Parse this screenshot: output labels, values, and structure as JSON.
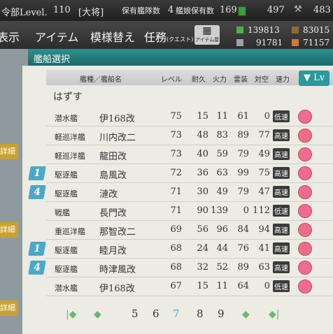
{
  "topbar": {
    "hq": "令部Level.",
    "level": "110",
    "rank": "[大将]",
    "ship_label": "保有艦隊数",
    "ship_value": "4",
    "equip_label": "艦娘保有数",
    "equip_value": "169",
    "bucket_value": "497",
    "c2_value": "483"
  },
  "menu": {
    "m1": "表示",
    "m2": "アイテム",
    "m3": "模様替え",
    "m4": "任務",
    "m4_sub": "(クエスト)",
    "itemshop": "アイテム屋"
  },
  "resources": {
    "fuel": "139813",
    "ammo": "83015",
    "steel": "91781",
    "bauxite": "71157"
  },
  "section_title": "艦船選択",
  "table": {
    "col_name": "艦種／艦船名",
    "col_level": "レベル",
    "col_hp": "耐久",
    "col_fp": "火力",
    "col_tp": "雷装",
    "col_aa": "対空",
    "col_speed": "速力",
    "sort_label": "▼ Lv",
    "remove": "はずす",
    "rows": [
      {
        "type": "潜水艦",
        "name": "伊168改",
        "lv": "75",
        "hp": "15",
        "fp": "11",
        "tp": "61",
        "aa": "0",
        "speed": "低速",
        "badge": ""
      },
      {
        "type": "軽巡洋艦",
        "name": "川内改二",
        "lv": "73",
        "hp": "48",
        "fp": "83",
        "tp": "89",
        "aa": "77",
        "speed": "高速",
        "badge": ""
      },
      {
        "type": "軽巡洋艦",
        "name": "龍田改",
        "lv": "73",
        "hp": "40",
        "fp": "59",
        "tp": "79",
        "aa": "49",
        "speed": "高速",
        "badge": ""
      },
      {
        "type": "駆逐艦",
        "name": "島風改",
        "lv": "72",
        "hp": "36",
        "fp": "63",
        "tp": "99",
        "aa": "75",
        "speed": "高速",
        "badge": "1"
      },
      {
        "type": "駆逐艦",
        "name": "漣改",
        "lv": "71",
        "hp": "30",
        "fp": "49",
        "tp": "79",
        "aa": "47",
        "speed": "高速",
        "badge": "4"
      },
      {
        "type": "戦艦",
        "name": "長門改",
        "lv": "71",
        "hp": "90",
        "fp": "139",
        "tp": "0",
        "aa": "112",
        "speed": "低速",
        "badge": ""
      },
      {
        "type": "重巡洋艦",
        "name": "那智改二",
        "lv": "69",
        "hp": "56",
        "fp": "96",
        "tp": "84",
        "aa": "94",
        "speed": "高速",
        "badge": ""
      },
      {
        "type": "駆逐艦",
        "name": "睦月改",
        "lv": "68",
        "hp": "24",
        "fp": "44",
        "tp": "76",
        "aa": "41",
        "speed": "高速",
        "badge": "1"
      },
      {
        "type": "駆逐艦",
        "name": "時津風改",
        "lv": "68",
        "hp": "32",
        "fp": "52",
        "tp": "89",
        "aa": "63",
        "speed": "高速",
        "badge": "4"
      },
      {
        "type": "潜水艦",
        "name": "伊168改",
        "lv": "67",
        "hp": "15",
        "fp": "11",
        "tp": "64",
        "aa": "0",
        "speed": "低速",
        "badge": ""
      }
    ]
  },
  "left_detail": "詳細",
  "pager": [
    "5",
    "6",
    "7",
    "8",
    "9"
  ],
  "pager_current": "7"
}
